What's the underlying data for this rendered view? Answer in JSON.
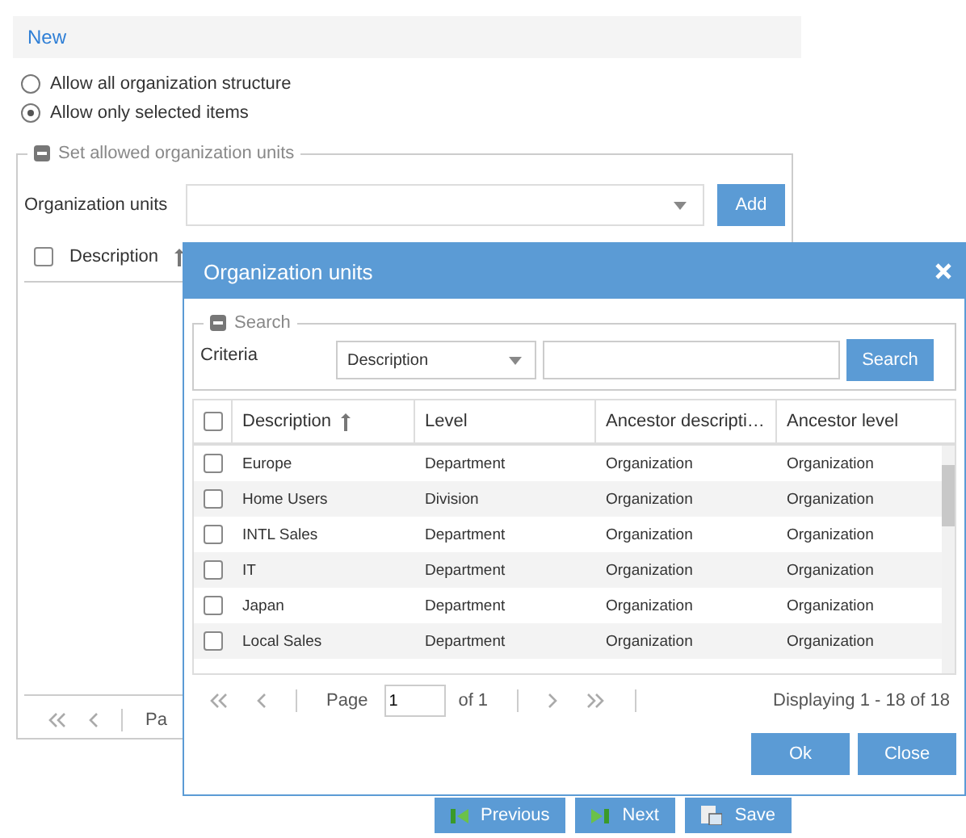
{
  "panel": {
    "title": "New"
  },
  "scope_options": [
    {
      "label": "Allow all organization structure",
      "selected": false
    },
    {
      "label": "Allow only selected items",
      "selected": true
    }
  ],
  "allowed_units": {
    "legend": "Set allowed organization units",
    "field_label": "Organization units",
    "add_button": "Add",
    "grid_columns": [
      {
        "label": "Description",
        "sorted": true,
        "checked": false
      }
    ],
    "pager": {
      "page_label": "Pa"
    }
  },
  "dialog": {
    "title": "Organization units",
    "search": {
      "legend": "Search",
      "criteria_label": "Criteria",
      "criteria_value": "Description",
      "search_button": "Search"
    },
    "columns": [
      {
        "label": "Description",
        "sorted": true
      },
      {
        "label": "Level",
        "sorted": false
      },
      {
        "label": "Ancestor descripti…",
        "sorted": false
      },
      {
        "label": "Ancestor level",
        "sorted": false
      }
    ],
    "header_checked": false,
    "rows": [
      {
        "checked": false,
        "cells": [
          "Europe",
          "Department",
          "Organization",
          "Organization"
        ]
      },
      {
        "checked": false,
        "cells": [
          "Home Users",
          "Division",
          "Organization",
          "Organization"
        ]
      },
      {
        "checked": false,
        "cells": [
          "INTL Sales",
          "Department",
          "Organization",
          "Organization"
        ]
      },
      {
        "checked": false,
        "cells": [
          "IT",
          "Department",
          "Organization",
          "Organization"
        ]
      },
      {
        "checked": false,
        "cells": [
          "Japan",
          "Department",
          "Organization",
          "Organization"
        ]
      },
      {
        "checked": false,
        "cells": [
          "Local Sales",
          "Department",
          "Organization",
          "Organization"
        ]
      }
    ],
    "pager": {
      "page_label": "Page",
      "page_value": "1",
      "of_label": "of 1",
      "summary": "Displaying 1 - 18 of 18"
    },
    "buttons": [
      "Ok",
      "Close"
    ]
  },
  "footer_buttons": [
    {
      "label": "Previous",
      "kind": "previous"
    },
    {
      "label": "Next",
      "kind": "next"
    },
    {
      "label": "Save",
      "kind": "save"
    }
  ]
}
